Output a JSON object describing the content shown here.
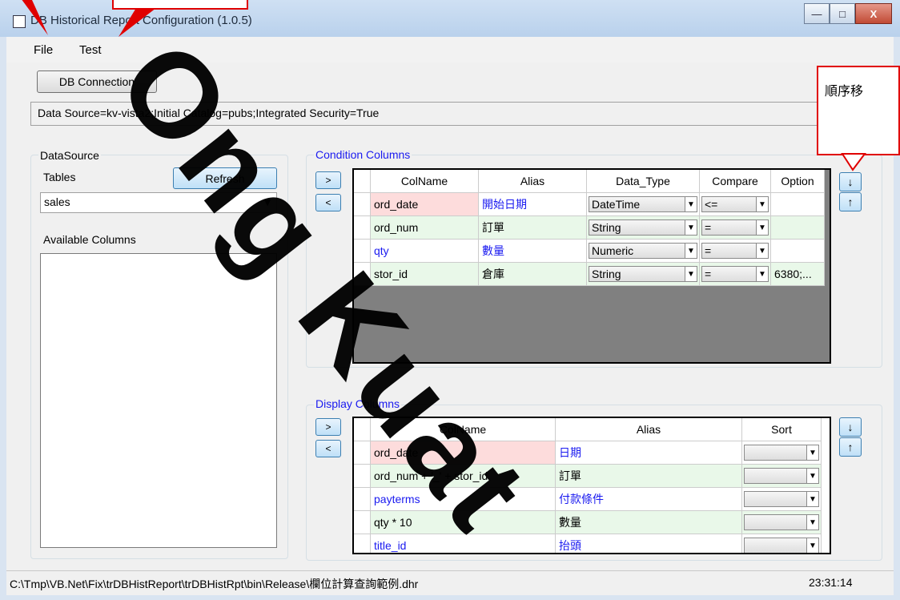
{
  "window": {
    "title": "DB Historical Report Configuration (1.0.5)",
    "controls": {
      "minimize": "—",
      "maximize": "□",
      "close": "X"
    }
  },
  "menu": {
    "file": "File",
    "test": "Test"
  },
  "connection": {
    "button": "DB Connection",
    "string": "Data Source=kv-vista2;Initial Catalog=pubs;Integrated Security=True"
  },
  "callout": {
    "text": "順序移"
  },
  "datasource": {
    "group_label": "DataSource",
    "tables_label": "Tables",
    "refresh_button": "Refresh",
    "table_selected": "sales",
    "available_label": "Available Columns"
  },
  "condition": {
    "group_label": "Condition Columns",
    "add_button": ">",
    "remove_button": "<",
    "headers": [
      "ColName",
      "Alias",
      "Data_Type",
      "Compare",
      "Option"
    ],
    "rows": [
      {
        "colname": "ord_date",
        "alias": "開始日期",
        "data_type": "DateTime",
        "compare": "<=",
        "option": ""
      },
      {
        "colname": "ord_num",
        "alias": "訂單",
        "data_type": "String",
        "compare": "=",
        "option": ""
      },
      {
        "colname": "qty",
        "alias": "數量",
        "data_type": "Numeric",
        "compare": "=",
        "option": ""
      },
      {
        "colname": "stor_id",
        "alias": "倉庫",
        "data_type": "String",
        "compare": "=",
        "option": "6380;..."
      }
    ],
    "down_button": "↓",
    "up_button": "↑"
  },
  "display": {
    "group_label": "Display Columns",
    "add_button": ">",
    "remove_button": "<",
    "headers": [
      "ColName",
      "Alias",
      "Sort"
    ],
    "rows": [
      {
        "colname": "ord_date",
        "alias": "日期",
        "sort": ""
      },
      {
        "colname": "ord_num + '_' + stor_id",
        "alias": "訂單",
        "sort": ""
      },
      {
        "colname": "payterms",
        "alias": "付款條件",
        "sort": ""
      },
      {
        "colname": "qty * 10",
        "alias": "數量",
        "sort": ""
      },
      {
        "colname": "title_id",
        "alias": "抬頭",
        "sort": ""
      }
    ],
    "down_button": "↓",
    "up_button": "↑"
  },
  "status": {
    "path": "C:\\Tmp\\VB.Net\\Fix\\trDBHistReport\\trDBHistRpt\\bin\\Release\\欄位計算查詢範例.dhr",
    "time": "23:31:14"
  },
  "watermark": "Ong Kuat",
  "colors": {
    "accent_blue": "#1a1af0",
    "row_pink": "#fddcdc",
    "row_green": "#e9f8e9",
    "callout_red": "#e00000"
  }
}
